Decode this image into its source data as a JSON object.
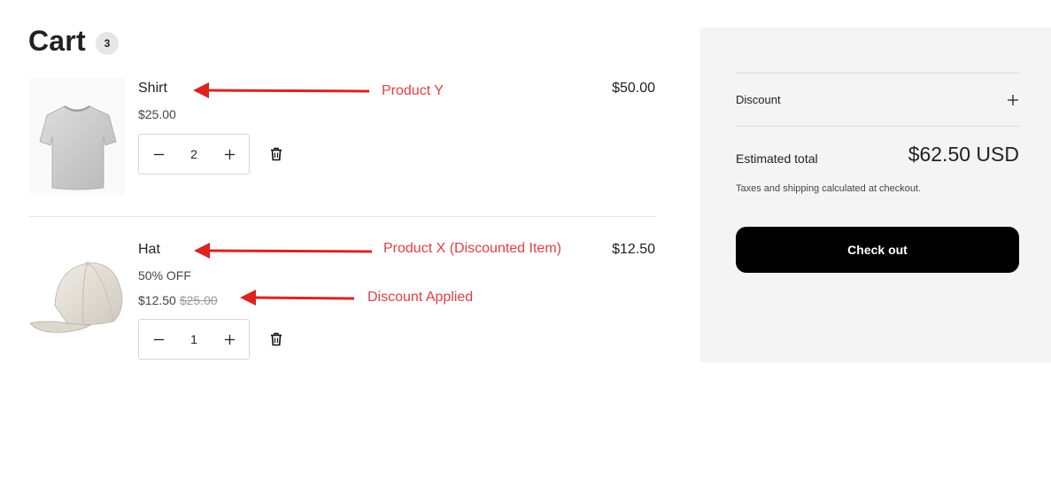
{
  "cart": {
    "title": "Cart",
    "count": "3"
  },
  "items": [
    {
      "name": "Shirt",
      "price": "$25.00",
      "quantity": "2",
      "line_total": "$50.00",
      "image": "tshirt-image"
    },
    {
      "name": "Hat",
      "badge": "50% OFF",
      "price": "$12.50",
      "compare_price": "$25.00",
      "quantity": "1",
      "line_total": "$12.50",
      "image": "cap-image"
    }
  ],
  "annotations": {
    "product_y": "Product Y",
    "product_x": "Product X (Discounted Item)",
    "discount_applied": "Discount Applied",
    "color": "#e04040"
  },
  "summary": {
    "discount_label": "Discount",
    "estimated_total_label": "Estimated total",
    "estimated_total_value": "$62.50 USD",
    "tax_note": "Taxes and shipping calculated at checkout.",
    "checkout_label": "Check out",
    "checkout_color": "#000000",
    "panel_color": "#f4f4f4"
  },
  "icons": {
    "decrease": "minus-icon",
    "increase": "plus-icon",
    "remove": "trash-icon",
    "discount_toggle": "plus-icon"
  }
}
